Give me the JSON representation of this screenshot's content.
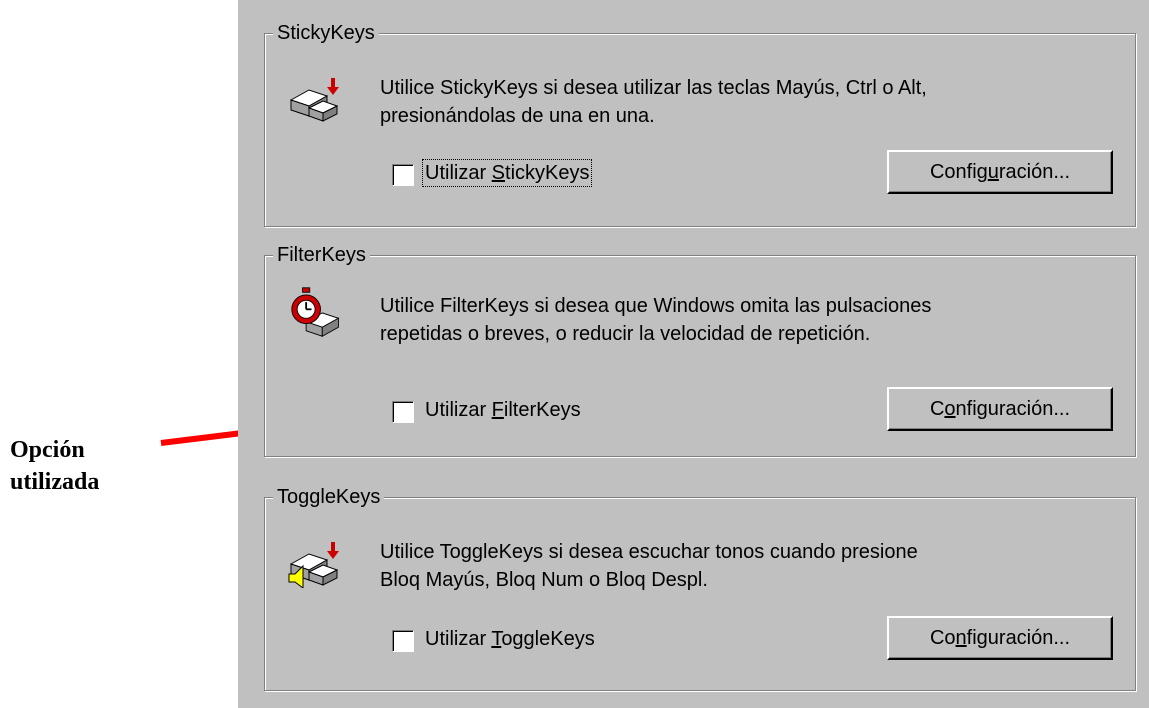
{
  "annotation": {
    "line1": "Opción",
    "line2": "utilizada",
    "arrow_color": "#ff0000"
  },
  "dialog_background": "#c0c0c0",
  "groups": [
    {
      "legend": "StickyKeys",
      "icon": "keyboard-keys-arrow-icon",
      "description_line1": "Utilice StickyKeys si desea utilizar las teclas Mayús, Ctrl o Alt,",
      "description_line2": "presionándolas de una en una.",
      "checkbox_label_pre": "Utilizar ",
      "checkbox_label_key": "S",
      "checkbox_label_post": "tickyKeys",
      "checked": false,
      "button_pre": "Config",
      "button_key": "u",
      "button_post": "ración..."
    },
    {
      "legend": "FilterKeys",
      "icon": "stopwatch-key-icon",
      "description_line1": "Utilice FilterKeys si desea que Windows omita las pulsaciones",
      "description_line2": "repetidas o breves, o reducir la velocidad de repetición.",
      "checkbox_label_pre": "Utilizar ",
      "checkbox_label_key": "F",
      "checkbox_label_post": "ilterKeys",
      "checked": false,
      "button_pre": "C",
      "button_key": "o",
      "button_post": "nfiguración..."
    },
    {
      "legend": "ToggleKeys",
      "icon": "keyboard-speaker-icon",
      "description_line1": "Utilice ToggleKeys si desea escuchar tonos cuando presione",
      "description_line2": "Bloq Mayús, Bloq Num o Bloq Despl.",
      "checkbox_label_pre": "Utilizar ",
      "checkbox_label_key": "T",
      "checkbox_label_post": "oggleKeys",
      "checked": false,
      "button_pre": "Co",
      "button_key": "n",
      "button_post": "figuración..."
    }
  ]
}
